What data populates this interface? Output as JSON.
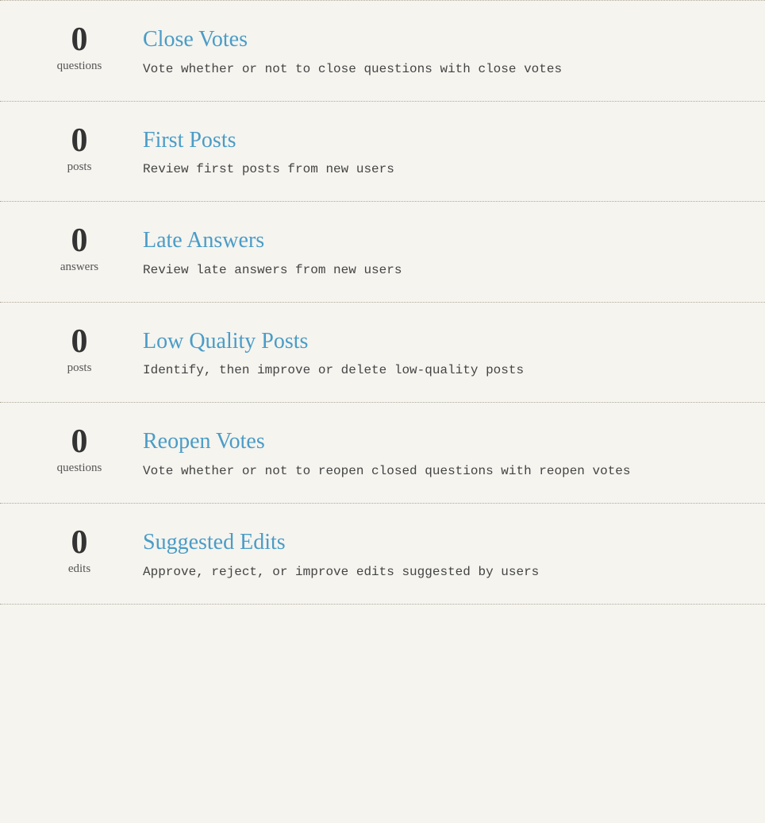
{
  "review_items": [
    {
      "count": "0",
      "unit": "questions",
      "title": "Close Votes",
      "description": "Vote whether or not to close questions with close votes"
    },
    {
      "count": "0",
      "unit": "posts",
      "title": "First Posts",
      "description": "Review first posts from new users"
    },
    {
      "count": "0",
      "unit": "answers",
      "title": "Late Answers",
      "description": "Review late answers from new users"
    },
    {
      "count": "0",
      "unit": "posts",
      "title": "Low Quality Posts",
      "description": "Identify, then improve or delete low-quality posts"
    },
    {
      "count": "0",
      "unit": "questions",
      "title": "Reopen Votes",
      "description": "Vote whether or not to reopen closed questions with reopen votes"
    },
    {
      "count": "0",
      "unit": "edits",
      "title": "Suggested Edits",
      "description": "Approve, reject, or improve edits suggested by users"
    }
  ]
}
